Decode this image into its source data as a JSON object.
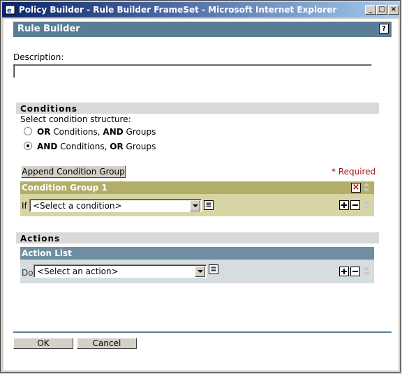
{
  "window": {
    "title": "Policy Builder - Rule Builder FrameSet - Microsoft Internet Explorer",
    "minimize": "_",
    "maximize": "□",
    "close": "×"
  },
  "header": {
    "title": "Rule Builder",
    "help": "?"
  },
  "description": {
    "label": "Description:",
    "value": ""
  },
  "conditions": {
    "section_title": "Conditions",
    "structure_label": "Select condition structure:",
    "option1": {
      "a": "OR",
      "b": " Conditions, ",
      "c": "AND",
      "d": " Groups"
    },
    "option2": {
      "a": "AND",
      "b": " Conditions, ",
      "c": "OR",
      "d": " Groups"
    },
    "selected": 2,
    "append_button": "Append Condition Group",
    "required": "* Required",
    "group": {
      "title": "Condition Group 1",
      "if_label": "If",
      "select_value": "<Select a condition>"
    }
  },
  "actions": {
    "section_title": "Actions",
    "list_title": "Action List",
    "do_label": "Do",
    "select_value": "<Select an action>"
  },
  "footer": {
    "ok": "OK",
    "cancel": "Cancel"
  }
}
